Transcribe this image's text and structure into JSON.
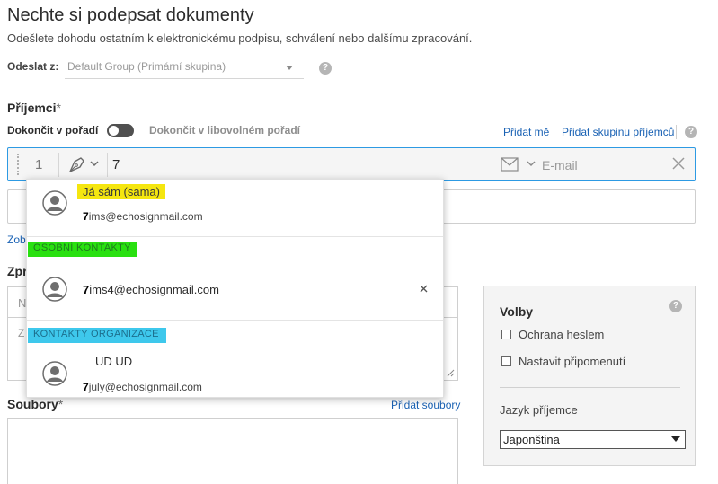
{
  "header": {
    "title": "Nechte si podepsat dokumenty",
    "subtitle": "Odešlete dohodu ostatním k elektronickému podpisu, schválení nebo dalšímu zpracování."
  },
  "send_from": {
    "label": "Odeslat z:",
    "value": "Default Group (Primární skupina)",
    "help": "?"
  },
  "recipients": {
    "heading": "Příjemci",
    "required": "*",
    "complete_in_order": "Dokončit v pořadí",
    "complete_any_order": "Dokončit v libovolném pořadí",
    "add_me": "Přidat mě",
    "add_group": "Přidat skupinu příjemců",
    "help": "?",
    "row": {
      "number": "1",
      "typed_value": "7",
      "email_placeholder": "E-mail"
    },
    "partial_link": "Zob"
  },
  "message": {
    "heading_partial": "Zpr",
    "name_placeholder_partial": "N",
    "body_placeholder_partial": "Z"
  },
  "files": {
    "heading": "Soubory",
    "required": "*",
    "add_files": "Přidat soubory"
  },
  "options": {
    "title": "Volby",
    "help": "?",
    "password_protection": "Ochrana heslem",
    "set_reminder": "Nastavit připomenutí",
    "recipient_language_label": "Jazyk příjemce",
    "recipient_language_value": "Japonština"
  },
  "dropdown": {
    "self_name": "Já sám (sama)",
    "self_email_match": "7",
    "self_email_rest": "ims@echosignmail.com",
    "personal_contacts_header": "OSOBNÍ KONTAKTY",
    "personal_email_match": "7",
    "personal_email_rest": "ims4@echosignmail.com",
    "org_contacts_header": "KONTAKTY ORGANIZACE",
    "org_name": "UD UD",
    "org_email_match": "7",
    "org_email_rest": "july@echosignmail.com"
  },
  "colors": {
    "highlight_yellow": "#f5e60f",
    "highlight_green": "#29e010",
    "highlight_cyan": "#3ec8ec",
    "link_blue": "#1a62b4",
    "focus_border": "#2d9ae3"
  },
  "icons": {
    "role": "pen-nib-icon",
    "email": "envelope-icon",
    "clear": "close-icon",
    "avatar": "user-avatar-icon",
    "help": "help-circle-icon"
  }
}
